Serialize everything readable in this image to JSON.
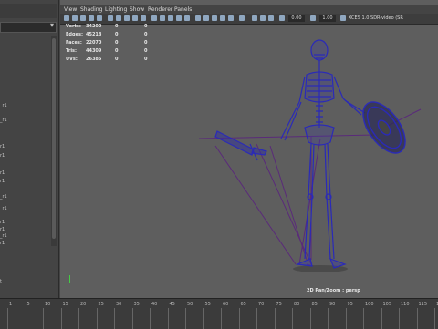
{
  "outliner": {
    "items": [
      "_r1",
      "_r1",
      "r1",
      "r1",
      "r1",
      "r1",
      "_r1",
      "_r1",
      "r1",
      "r1",
      "_r1",
      "r1",
      "t"
    ]
  },
  "menu": {
    "items": [
      "View",
      "Shading",
      "Lighting",
      "Show",
      "Renderer",
      "Panels"
    ]
  },
  "toolbar": {
    "field1": "0.00",
    "field2": "1.00",
    "colorspace": "XCES 1.0 SDR-video (SR"
  },
  "hud": {
    "rows": [
      {
        "label": "Verts:",
        "v1": "34200",
        "v2": "0",
        "v3": "0"
      },
      {
        "label": "Edges:",
        "v1": "45218",
        "v2": "0",
        "v3": "0"
      },
      {
        "label": "Faces:",
        "v1": "22070",
        "v2": "0",
        "v3": "0"
      },
      {
        "label": "Tris:",
        "v1": "44309",
        "v2": "0",
        "v3": "0"
      },
      {
        "label": "UVs:",
        "v1": "26385",
        "v2": "0",
        "v3": "0"
      }
    ]
  },
  "camera_label": "2D Pan/Zoom : persp",
  "timeline": {
    "ticks": [
      "1",
      "5",
      "10",
      "15",
      "20",
      "25",
      "30",
      "35",
      "40",
      "45",
      "50",
      "55",
      "60",
      "65",
      "70",
      "75",
      "80",
      "85",
      "90",
      "95",
      "100",
      "105",
      "110",
      "115",
      "120"
    ]
  },
  "colors": {
    "wire": "#2b2bb8",
    "skeleton_line": "#5a2a7a",
    "viewport_bg": "#5e5e5e"
  }
}
